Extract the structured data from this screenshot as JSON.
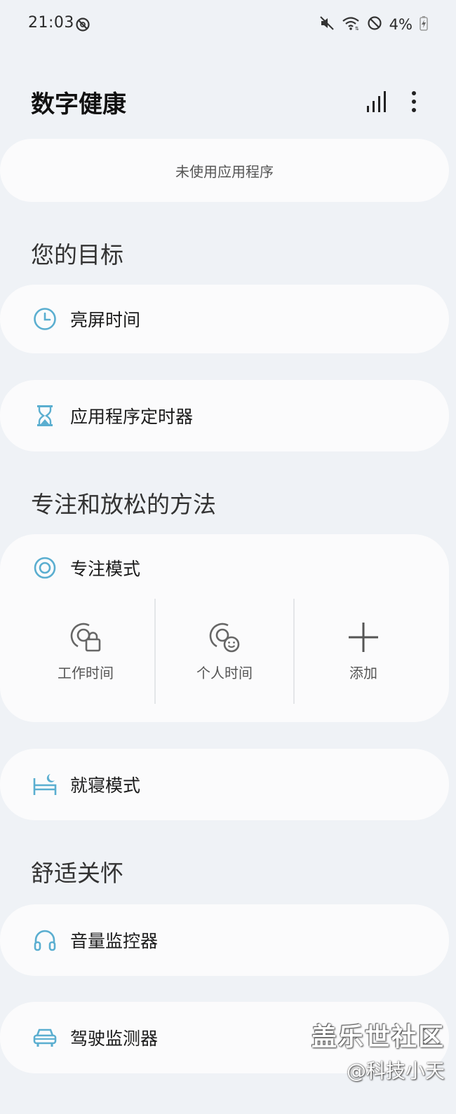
{
  "status_bar": {
    "time": "21:03",
    "battery": "4%",
    "icons": [
      "do-not-disturb-icon",
      "mute-icon",
      "wifi-icon",
      "blocked-icon",
      "battery-charging-icon"
    ]
  },
  "header": {
    "title": "数字健康",
    "icons": [
      "bar-chart-icon",
      "more-vert-icon"
    ]
  },
  "unused_apps": {
    "label": "未使用应用程序"
  },
  "goals": {
    "title": "您的目标",
    "items": [
      {
        "label": "亮屏时间",
        "icon": "clock-icon"
      },
      {
        "label": "应用程序定时器",
        "icon": "hourglass-icon"
      }
    ]
  },
  "focus": {
    "title": "专注和放松的方法",
    "mode": {
      "label": "专注模式",
      "icon": "focus-target-icon"
    },
    "items": [
      {
        "label": "工作时间",
        "icon": "work-lock-icon"
      },
      {
        "label": "个人时间",
        "icon": "personal-smile-icon"
      },
      {
        "label": "添加",
        "icon": "plus-icon"
      }
    ],
    "bedtime": {
      "label": "就寝模式",
      "icon": "bed-moon-icon"
    }
  },
  "wellbeing": {
    "title": "舒适关怀",
    "items": [
      {
        "label": "音量监控器",
        "icon": "headphones-icon"
      },
      {
        "label": "驾驶监测器",
        "icon": "car-icon"
      }
    ]
  },
  "watermark": {
    "main": "盖乐世社区",
    "sub": "@科技小天"
  },
  "colors": {
    "background": "#eff2f6",
    "card": "#fbfbfc",
    "accent": "#5aaed0"
  }
}
